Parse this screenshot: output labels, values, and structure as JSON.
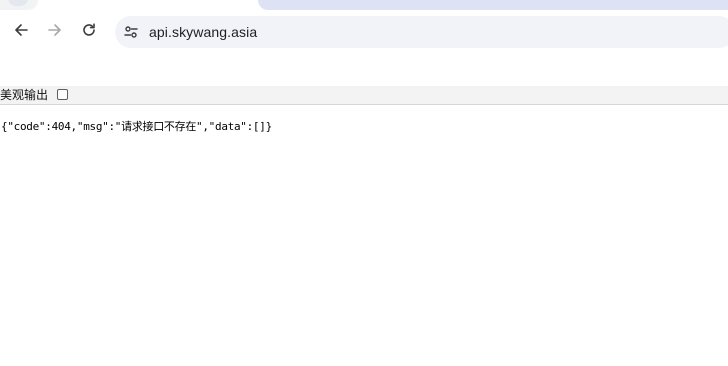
{
  "browser": {
    "address_bar": {
      "url": "api.skywang.asia"
    },
    "icons": {
      "back": "arrow-left-icon",
      "forward": "arrow-right-icon",
      "reload": "reload-icon",
      "site_info": "tune-icon"
    }
  },
  "page": {
    "pretty_print_label": "美观输出",
    "pretty_print_checked": false,
    "json_text": "{\"code\":404,\"msg\":\"请求接口不存在\",\"data\":[]}"
  },
  "colors": {
    "active_tab_strip": "#dde3f4",
    "omnibox_bg": "#f1f3f8",
    "control_bar_bg": "#f3f3f3"
  }
}
